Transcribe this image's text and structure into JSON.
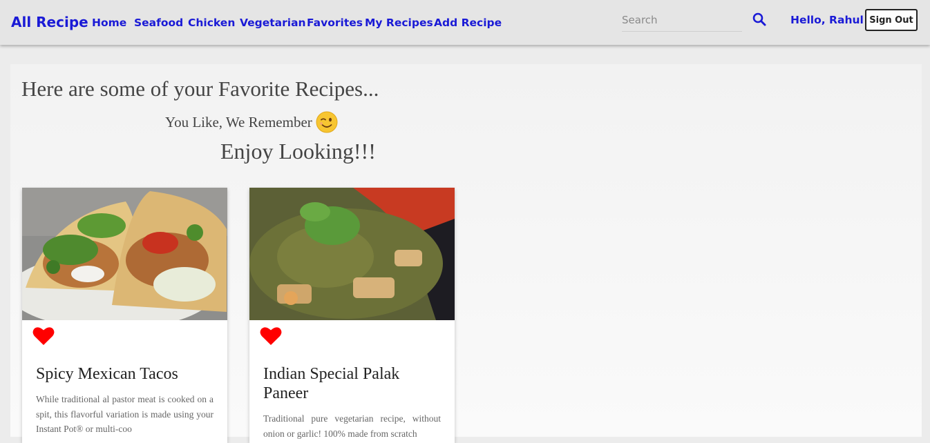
{
  "nav": {
    "brand": "All Recipe",
    "links": [
      "Home",
      "Seafood",
      "Chicken",
      "Vegetarian",
      "Favorites",
      "My Recipes",
      "Add Recipe"
    ],
    "search_placeholder": "Search",
    "search_icon": "magnifier-icon",
    "greeting": "Hello, Rahul",
    "signout_label": "Sign Out",
    "link_color": "#1a1ad6"
  },
  "page": {
    "heading": "Here are some of your Favorite Recipes...",
    "tagline": "You Like, We Remember",
    "tagline_emoji": "winking-face-icon",
    "enjoy": "Enjoy Looking!!!"
  },
  "recipes": [
    {
      "title": "Spicy Mexican Tacos",
      "description": "While traditional al pastor meat is cooked on a spit, this flavorful variation is made using your Instant Pot® or multi-coo",
      "image": "fish-tacos-photo",
      "favorite": true,
      "heart_color": "#ff0000"
    },
    {
      "title": "Indian Special Palak Paneer",
      "description": "Traditional pure vegetarian recipe, without onion or garlic! 100% made from scratch",
      "image": "palak-paneer-photo",
      "favorite": true,
      "heart_color": "#ff0000"
    }
  ]
}
